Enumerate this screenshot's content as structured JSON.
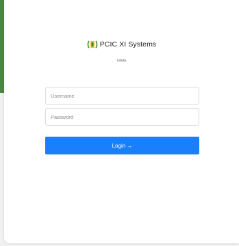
{
  "brand": {
    "title": "PCIC XI Systems",
    "subtitle": "vdeta",
    "logo_icon": "pcic-logo-icon"
  },
  "form": {
    "username_placeholder": "Username",
    "password_placeholder": "Password",
    "login_label": "Login →"
  },
  "colors": {
    "accent_green": "#4a8a3e",
    "button_blue": "#1a7ffa"
  }
}
